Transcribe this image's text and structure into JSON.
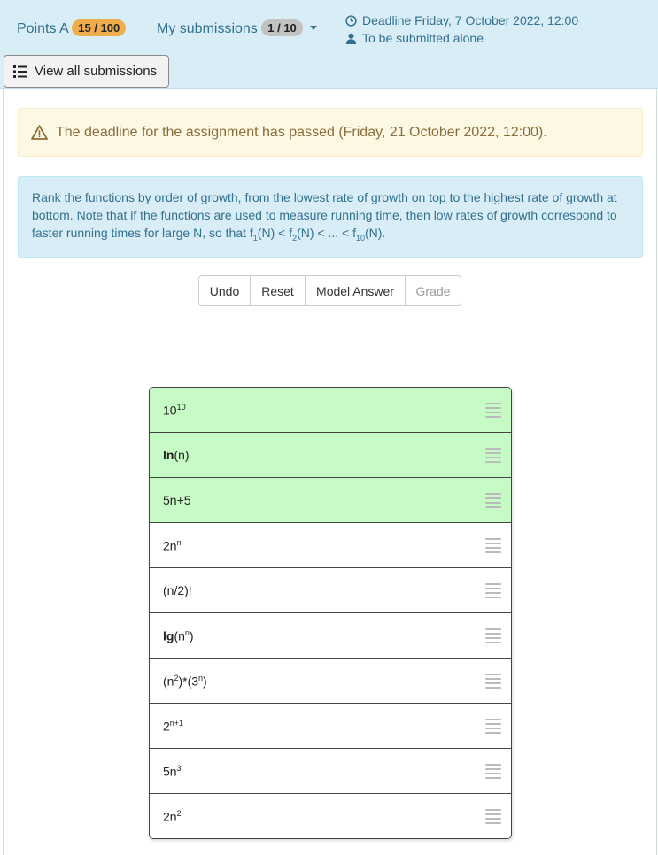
{
  "header": {
    "points_label": "Points A",
    "points_badge": "15 / 100",
    "submissions_label": "My submissions",
    "submissions_badge": "1 / 10",
    "deadline_text": "Deadline Friday, 7 October 2022, 12:00",
    "submit_mode_text": "To be submitted alone",
    "view_all_label": "View all submissions"
  },
  "warning_text": "The deadline for the assignment has passed (Friday, 21 October 2022, 12:00).",
  "instructions": {
    "text": "Rank the functions by order of growth, from the lowest rate of growth on top to the highest rate of growth at bottom. Note that if the functions are used to measure running time, then low rates of growth correspond to faster running times for large N, so that f",
    "sub1": "1",
    "mid1": "(N) < f",
    "sub2": "2",
    "mid2": "(N) < ... < f",
    "sub3": "10",
    "end": "(N)."
  },
  "buttons": {
    "undo": "Undo",
    "reset": "Reset",
    "model_answer": "Model Answer",
    "grade": "Grade"
  },
  "items": [
    {
      "base": "10",
      "sup": "10",
      "tail": "",
      "bold": "",
      "status": "correct"
    },
    {
      "bold": "ln",
      "base": "(n)",
      "sup": "",
      "tail": "",
      "status": "correct"
    },
    {
      "base": "5n+5",
      "sup": "",
      "tail": "",
      "bold": "",
      "status": "correct"
    },
    {
      "base": "2n",
      "sup": "n",
      "tail": "",
      "bold": "",
      "status": "neutral"
    },
    {
      "base": "(n/2)!",
      "sup": "",
      "tail": "",
      "bold": "",
      "status": "neutral"
    },
    {
      "bold": "lg",
      "base": "(n",
      "sup": "n",
      "tail": ")",
      "status": "neutral"
    },
    {
      "base": "(n",
      "sup": "2",
      "tail": ")*(3",
      "sup2": "n",
      "tail2": ")",
      "bold": "",
      "status": "neutral"
    },
    {
      "base": "2",
      "sup": "n+1",
      "tail": "",
      "bold": "",
      "status": "neutral"
    },
    {
      "base": "5n",
      "sup": "3",
      "tail": "",
      "bold": "",
      "status": "neutral"
    },
    {
      "base": "2n",
      "sup": "2",
      "tail": "",
      "bold": "",
      "status": "neutral"
    }
  ],
  "colors": {
    "correct_bg": "#c6fbc6",
    "header_bg": "#d9edf7",
    "warning_bg": "#fcf8e3",
    "points_badge_bg": "#f0ad4e"
  },
  "icons": {
    "deadline": "clock-icon",
    "submit_mode": "user-icon",
    "view_all": "list-icon",
    "warning": "warning-triangle-icon",
    "drag": "drag-handle-icon"
  }
}
